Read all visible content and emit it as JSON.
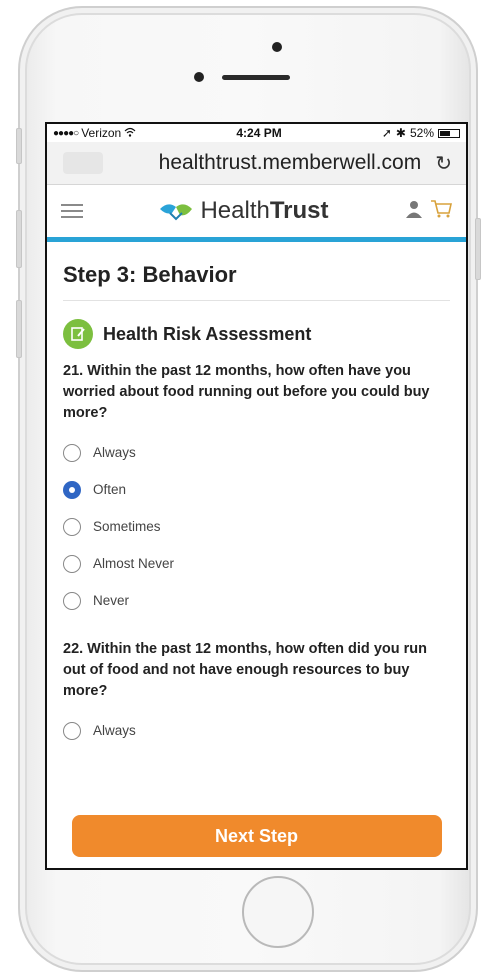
{
  "status": {
    "carrier": "Verizon",
    "time": "4:24 PM",
    "battery": "52%"
  },
  "browser": {
    "url": "healthtrust.memberwell.com"
  },
  "site": {
    "brand_light": "Health",
    "brand_bold": "Trust",
    "accent": "#29a3d6"
  },
  "page": {
    "step_title": "Step 3: Behavior",
    "section_title": "Health Risk Assessment"
  },
  "questions": [
    {
      "text": "21. Within the past 12 months, how often have you worried about food running out before you could buy more?",
      "options": [
        "Always",
        "Often",
        "Sometimes",
        "Almost Never",
        "Never"
      ],
      "selected": "Often"
    },
    {
      "text": "22. Within the past 12 months, how often did you run out of food and not have enough resources to buy more?",
      "options": [
        "Always"
      ]
    }
  ],
  "footer": {
    "next_label": "Next Step",
    "button_color": "#f08a2c"
  }
}
